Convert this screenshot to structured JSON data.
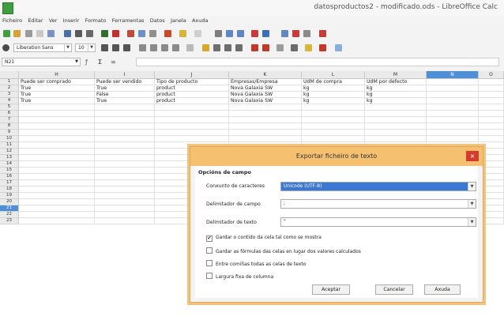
{
  "window": {
    "title": "datosproductos2 - modificado.ods - LibreOffice Calc"
  },
  "menubar": {
    "items": [
      "Ficheiro",
      "Editar",
      "Ver",
      "Inserir",
      "Formato",
      "Ferramentas",
      "Datos",
      "Janela",
      "Axuda"
    ]
  },
  "toolbar": {
    "font_name": "Liberation Sans",
    "font_size": "10"
  },
  "formulabar": {
    "cell_ref": "N21",
    "sum_symbol": "Σ",
    "equals_symbol": "="
  },
  "spreadsheet": {
    "columns": [
      "H",
      "I",
      "J",
      "K",
      "L",
      "M",
      "N",
      "O"
    ],
    "selected_column": "N",
    "rows": [
      "1",
      "2",
      "3",
      "4",
      "5",
      "6",
      "7",
      "8",
      "9",
      "10",
      "11",
      "12",
      "13",
      "14",
      "15",
      "16",
      "17",
      "18",
      "19",
      "20",
      "21",
      "22",
      "23"
    ],
    "selected_row": "21",
    "cells": [
      [
        "Puede ser comprado",
        "Puede ser vendido",
        "Tipo de producto",
        "Empresas/Empresa",
        "UdM de compra",
        "UdM por defecto"
      ],
      [
        "True",
        "True",
        "product",
        "Nova Galaxia SW",
        "kg",
        "kg"
      ],
      [
        "True",
        "False",
        "product",
        "Nova Galaxia SW",
        "kg",
        "kg"
      ],
      [
        "True",
        "True",
        "product",
        "Nova Galaxia SW",
        "kg",
        "kg"
      ]
    ]
  },
  "dialog": {
    "title": "Exportar ficheiro de texto",
    "close_glyph": "×",
    "section_title": "Opcións de campo",
    "charset_label": "Conxunto de caracteres",
    "charset_value": "Unicode (UTF-8)",
    "field_delim_label": "Delimitador de campo",
    "field_delim_value": ";",
    "text_delim_label": "Delimitador de texto",
    "text_delim_value": "\"",
    "checkboxes": [
      {
        "label": "Gardar o contido da cela tal como se mostra",
        "checked": true
      },
      {
        "label": "Gardar as fórmulas das celas en lugar dos valores calculados",
        "checked": false
      },
      {
        "label": "Entre comiñas todas as celas de texto",
        "checked": false
      },
      {
        "label": "Largura fixa de columna",
        "checked": false
      }
    ],
    "buttons": {
      "accept": "Aceptar",
      "cancel": "Cancelar",
      "help": "Axuda"
    }
  },
  "colors": {
    "dialog_title_bg": "#f5c070",
    "selection": "#3a78d6",
    "close_button": "#d33b2c"
  }
}
